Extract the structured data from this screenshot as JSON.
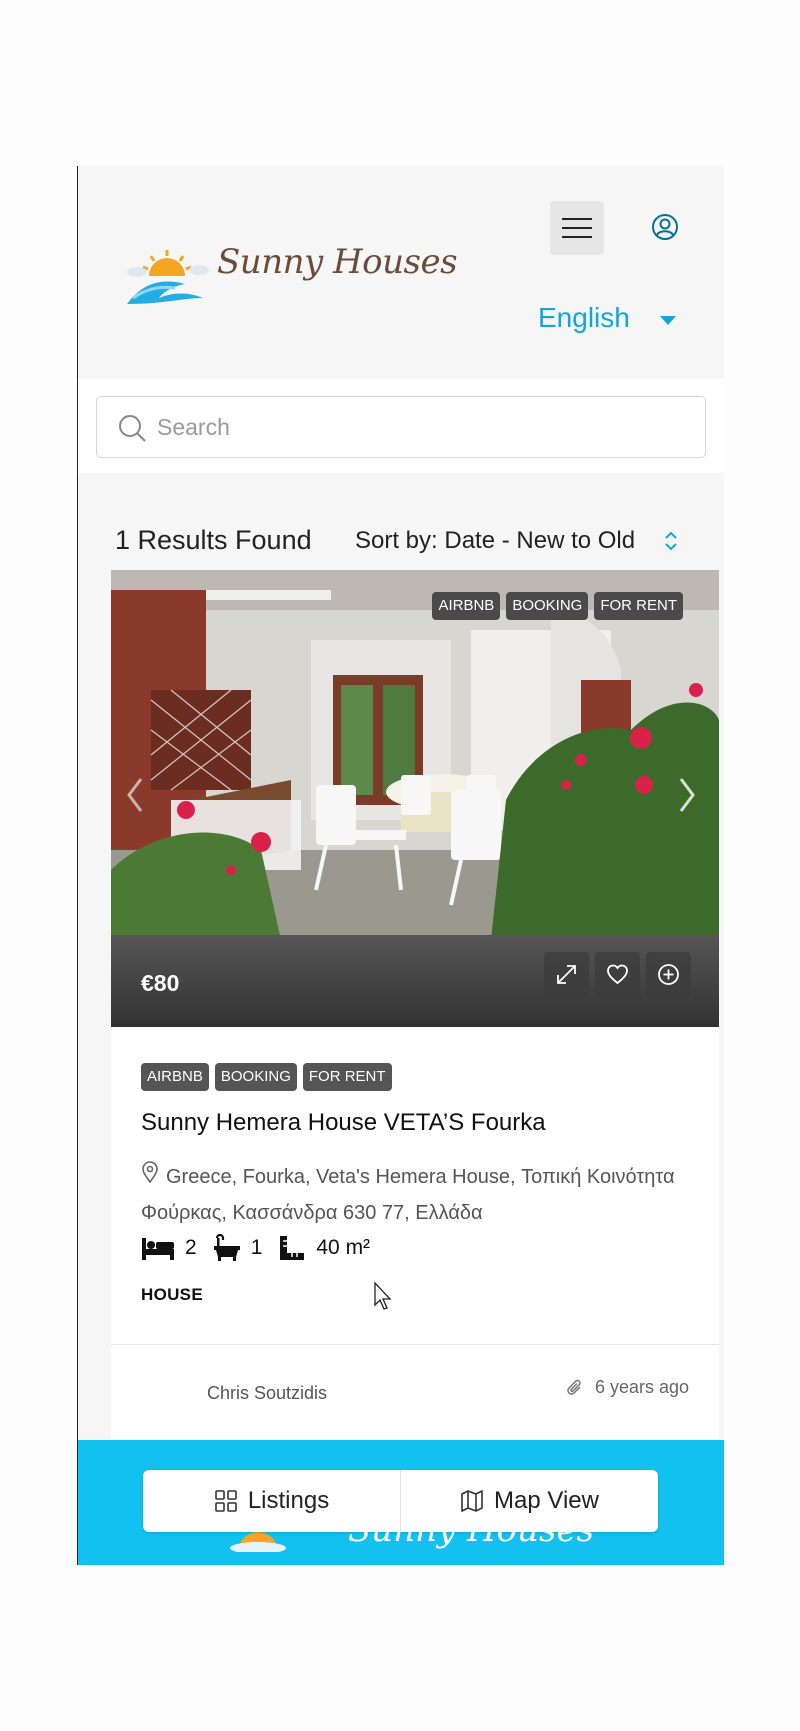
{
  "header": {
    "logo_text": "Sunny Houses",
    "language": "English"
  },
  "search": {
    "placeholder": "Search"
  },
  "results": {
    "count_label": "1 Results Found",
    "sort_label": "Sort by: Date - New to Old"
  },
  "listing": {
    "photo_tags": [
      "AIRBNB",
      "BOOKING",
      "FOR RENT"
    ],
    "price": "€80",
    "tags": [
      "AIRBNB",
      "BOOKING",
      "FOR RENT"
    ],
    "title": "Sunny Hemera House VETA’S Fourka",
    "address": "Greece, Fourka, Veta's Hemera House, Τοπική Κοινότητα Φούρκας, Κασσάνδρα 630 77, Ελλάδα",
    "bedrooms": "2",
    "bathrooms": "1",
    "area": "40 m²",
    "type": "HOUSE",
    "agent": "Chris Soutzidis",
    "posted": "6 years ago"
  },
  "footer": {
    "logo_text": "Sunny Houses",
    "listings_label": "Listings",
    "map_label": "Map View"
  },
  "colors": {
    "accent": "#11a6dd",
    "footer_bg": "#12c1ef",
    "tag_bg": "#4a4a4a"
  },
  "icons": [
    "menu-icon",
    "user-icon",
    "caret-down-icon",
    "search-icon",
    "sort-icon",
    "expand-icon",
    "heart-icon",
    "plus-circle-icon",
    "map-pin-icon",
    "bed-icon",
    "bath-icon",
    "ruler-icon",
    "paperclip-icon",
    "grid-icon",
    "map-icon",
    "chevron-left-icon",
    "chevron-right-icon"
  ]
}
